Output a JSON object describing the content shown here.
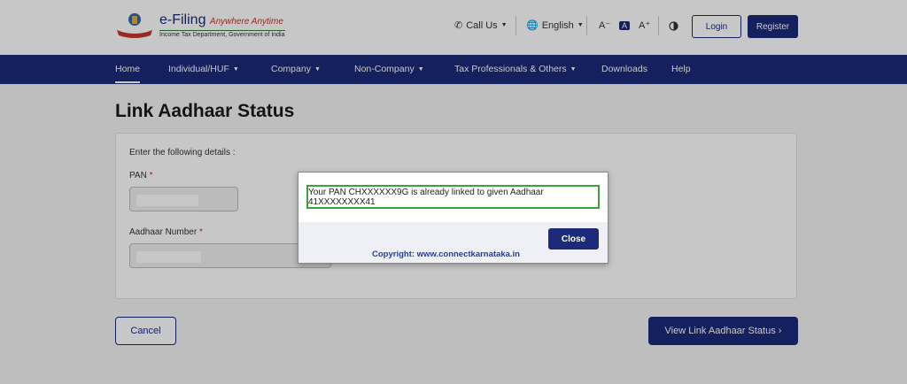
{
  "header": {
    "brand": "e-Filing",
    "tagline": "Anywhere Anytime",
    "department": "Income Tax Department, Government of India",
    "call_us": "Call Us",
    "language": "English",
    "font_decrease": "A⁻",
    "font_normal": "A",
    "font_increase": "A⁺",
    "contrast_icon": "contrast-icon",
    "login": "Login",
    "register": "Register"
  },
  "nav": {
    "items": [
      {
        "label": "Home"
      },
      {
        "label": "Individual/HUF"
      },
      {
        "label": "Company"
      },
      {
        "label": "Non-Company"
      },
      {
        "label": "Tax Professionals & Others"
      },
      {
        "label": "Downloads"
      },
      {
        "label": "Help"
      }
    ]
  },
  "page": {
    "title": "Link Aadhaar Status",
    "instruction": "Enter the following details :",
    "pan_label": "PAN",
    "aadhaar_label": "Aadhaar Number",
    "required_mark": "*",
    "cancel": "Cancel",
    "view_status": "View Link Aadhaar Status ›"
  },
  "modal": {
    "message": "Your PAN CHXXXXXX9G is already linked to given Aadhaar 41XXXXXXXX41",
    "close": "Close",
    "copyright": "Copyright: www.connectkarnataka.in"
  },
  "colors": {
    "primary": "#1c2a7a",
    "success_border": "#3aa33a",
    "required": "#c0392b"
  }
}
